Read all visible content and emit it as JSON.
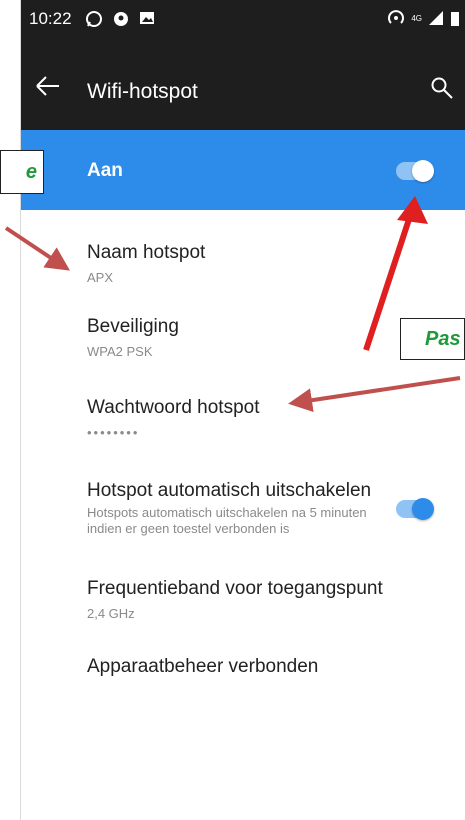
{
  "status_bar": {
    "time": "10:22",
    "right_indicator": "4G"
  },
  "toolbar": {
    "title": "Wifi-hotspot",
    "back_icon": "arrow-left-icon",
    "search_icon": "search-icon"
  },
  "master_switch": {
    "label": "Aan",
    "state": "on"
  },
  "settings": [
    {
      "title": "Naam hotspot",
      "subtitle": "APX"
    },
    {
      "title": "Beveiliging",
      "subtitle": "WPA2 PSK"
    },
    {
      "title": "Wachtwoord hotspot",
      "subtitle": "••••••••"
    },
    {
      "title": "Hotspot automatisch uitschakelen",
      "subtitle": "Hotspots automatisch uitschakelen na 5 minuten indien er geen toestel verbonden is",
      "toggle": "on"
    },
    {
      "title": "Frequentieband voor toegangspunt",
      "subtitle": "2,4 GHz"
    },
    {
      "title": "Apparaatbeheer verbonden",
      "subtitle": ""
    }
  ],
  "annotations": {
    "left_callout": "e",
    "right_callout": "Pas"
  },
  "colors": {
    "accent": "#2d8bea",
    "toolbar": "#1e1e1e",
    "callout_text": "#1f9a3a",
    "arrow": "#c0504d",
    "arrow_highlight": "#e02020"
  }
}
